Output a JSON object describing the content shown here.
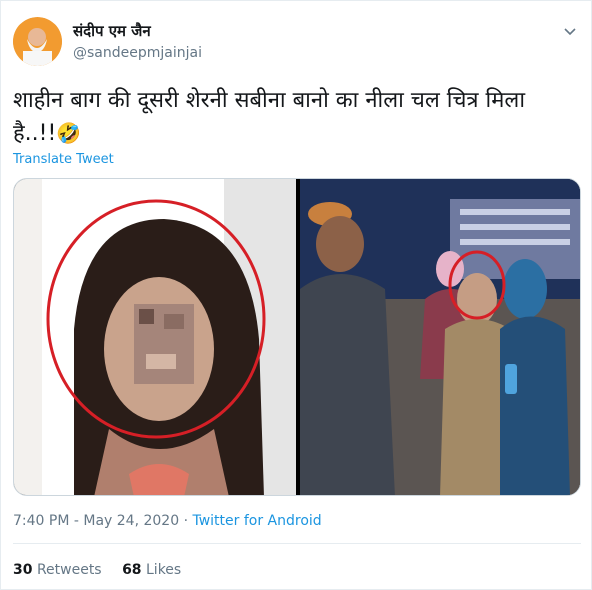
{
  "author": {
    "display_name": "संदीप एम जैन",
    "handle": "@sandeepmjainjai",
    "avatar_icon": "profile-photo"
  },
  "menu_icon": "chevron-down-icon",
  "tweet": {
    "text_line1": "शाहीन बाग की दूसरी शेरनी सबीना बानो का नीला चल चित्र मिला",
    "text_line2": "है..!!",
    "emoji": "🤣",
    "translate_label": "Translate Tweet"
  },
  "media": {
    "left_image": "Blurred-face photo of a woman circled in red",
    "right_image": "Group photo at night rally with a woman circled in red"
  },
  "meta": {
    "time": "7:40 PM",
    "date": "May 24, 2020",
    "separator": " · ",
    "source": "Twitter for Android"
  },
  "stats": {
    "retweets_count": "30",
    "retweets_label": "Retweets",
    "likes_count": "68",
    "likes_label": "Likes"
  },
  "colors": {
    "link": "#1b95e0",
    "muted": "#657786",
    "text": "#14171a",
    "circle": "#d61f26"
  }
}
